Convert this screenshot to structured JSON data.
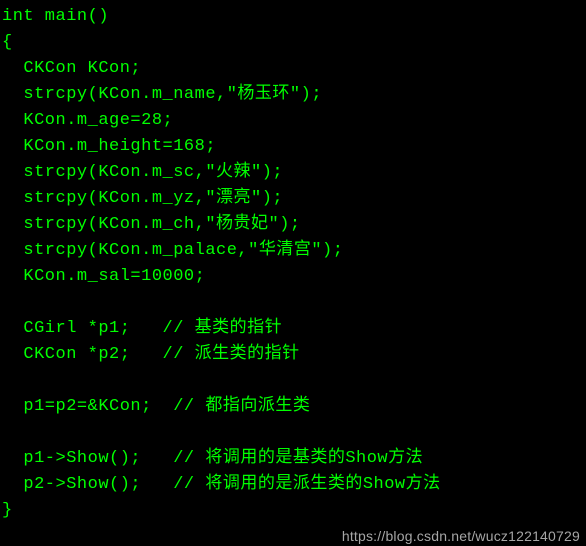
{
  "code": {
    "lines": [
      "int main()",
      "{",
      "  CKCon KCon;",
      "  strcpy(KCon.m_name,\"杨玉环\");",
      "  KCon.m_age=28;",
      "  KCon.m_height=168;",
      "  strcpy(KCon.m_sc,\"火辣\");",
      "  strcpy(KCon.m_yz,\"漂亮\");",
      "  strcpy(KCon.m_ch,\"杨贵妃\");",
      "  strcpy(KCon.m_palace,\"华清宫\");",
      "  KCon.m_sal=10000;",
      "",
      "  CGirl *p1;   // 基类的指针",
      "  CKCon *p2;   // 派生类的指针",
      "",
      "  p1=p2=&KCon;  // 都指向派生类",
      "",
      "  p1->Show();   // 将调用的是基类的Show方法",
      "  p2->Show();   // 将调用的是派生类的Show方法",
      "}"
    ]
  },
  "watermark": "https://blog.csdn.net/wucz122140729"
}
